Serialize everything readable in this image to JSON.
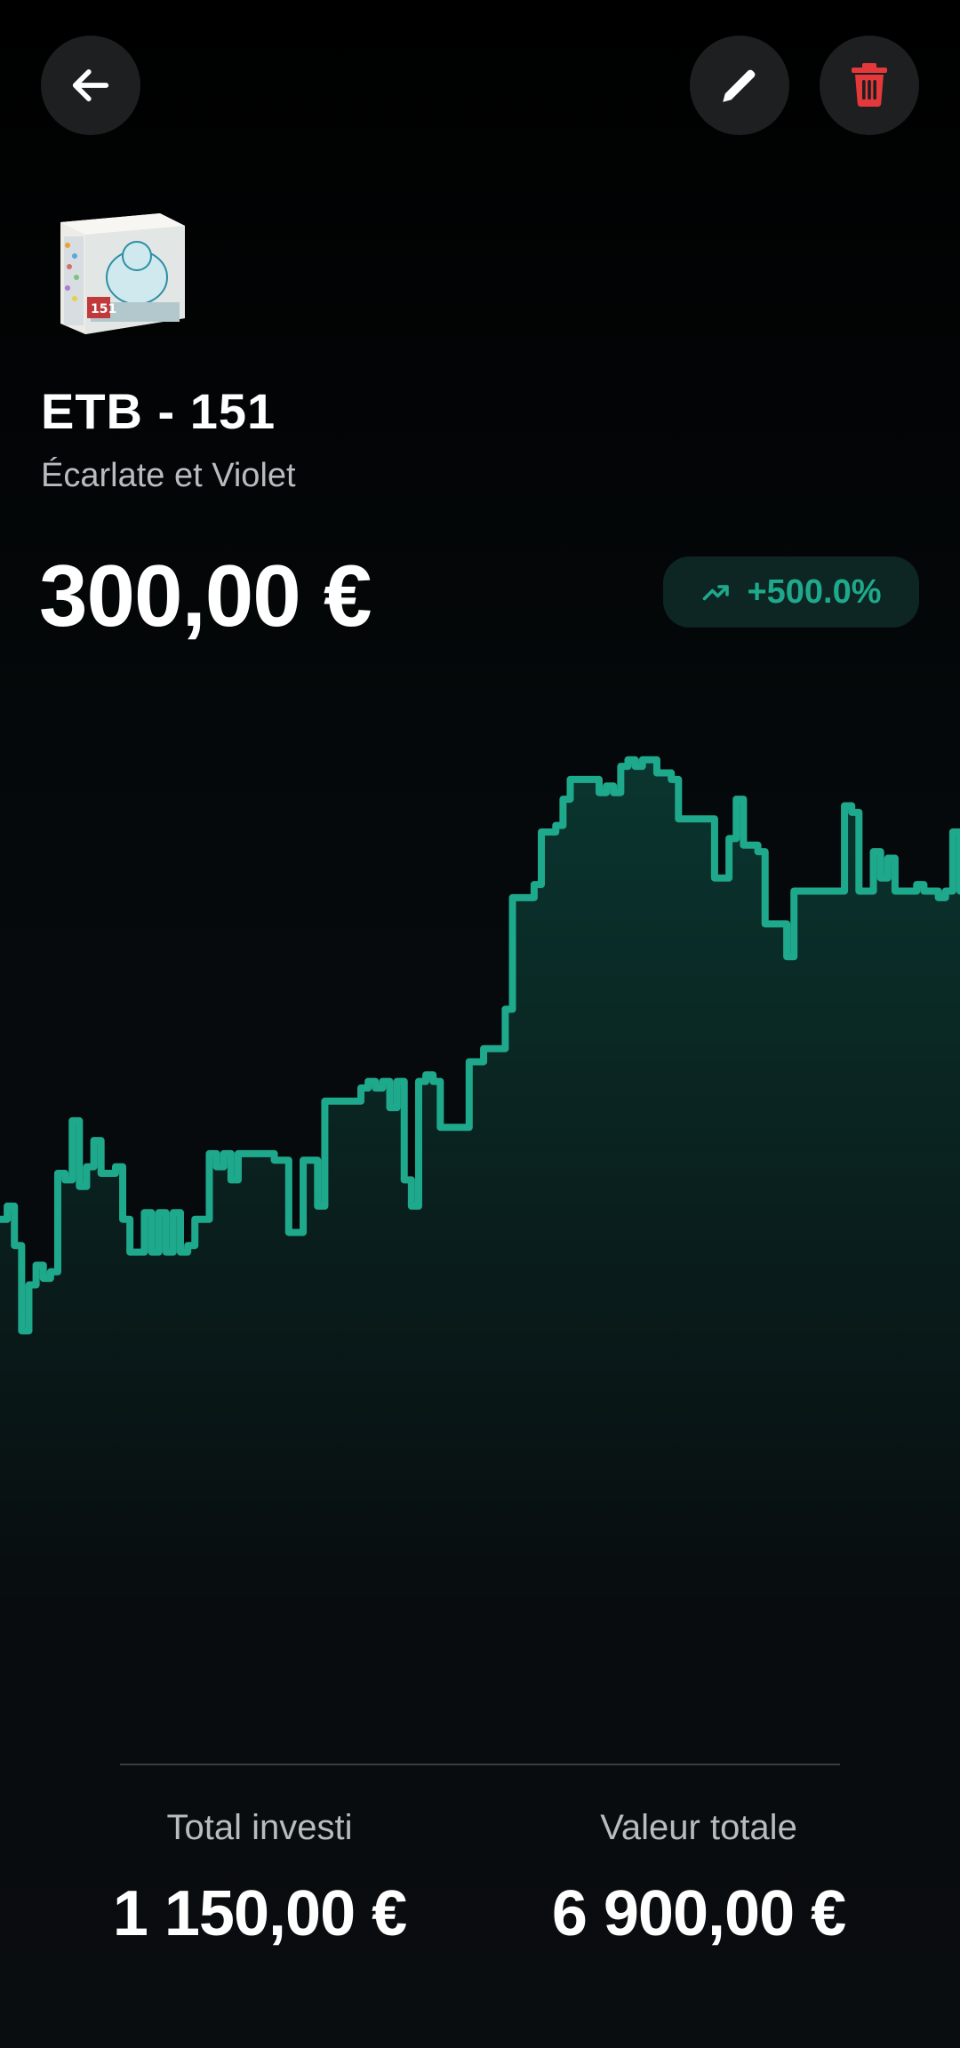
{
  "header": {
    "back_icon": "arrow-left-icon",
    "edit_icon": "pencil-icon",
    "delete_icon": "trash-icon",
    "delete_color": "#e5383b"
  },
  "product": {
    "image": "etb-151-box-thumbnail",
    "name": "ETB - 151",
    "set": "Écarlate et Violet",
    "price": "300,00 €",
    "change": "+500.0%",
    "change_icon": "trending-up-icon",
    "accent_color": "#1fa98c"
  },
  "chart_data": {
    "type": "area",
    "title": "",
    "xlabel": "",
    "ylabel": "",
    "series": [
      {
        "values": [
          58,
          60,
          54,
          41,
          48,
          51,
          49,
          50,
          65,
          64,
          73,
          63,
          66,
          70,
          65,
          65,
          66,
          58,
          53,
          53,
          59,
          53,
          59,
          53,
          59,
          53,
          54,
          58,
          58,
          68,
          66,
          68,
          64,
          68,
          68,
          68,
          68,
          68,
          67,
          67,
          56,
          56,
          67,
          67,
          60,
          76,
          76,
          76,
          76,
          76,
          78,
          79,
          78,
          79,
          75,
          79,
          64,
          60,
          79,
          80,
          79,
          72,
          72,
          72,
          72,
          82,
          82,
          84,
          84,
          84,
          90,
          107,
          107,
          107,
          109,
          117,
          117,
          118,
          122,
          125,
          125,
          125,
          125,
          123,
          124,
          123,
          127,
          128,
          127,
          128,
          128,
          126,
          126,
          125,
          119,
          119,
          119,
          119,
          119,
          110,
          110,
          116,
          122,
          115,
          115,
          114,
          103,
          103,
          103,
          98,
          108,
          108,
          108,
          108,
          108,
          108,
          108,
          121,
          120,
          108,
          108,
          114,
          110,
          113,
          108,
          108,
          108,
          109,
          108,
          108,
          107,
          108,
          117,
          108
        ]
      }
    ]
  },
  "stats": {
    "invested_label": "Total investi",
    "invested_value": "1 150,00 €",
    "total_label": "Valeur totale",
    "total_value": "6 900,00 €"
  }
}
